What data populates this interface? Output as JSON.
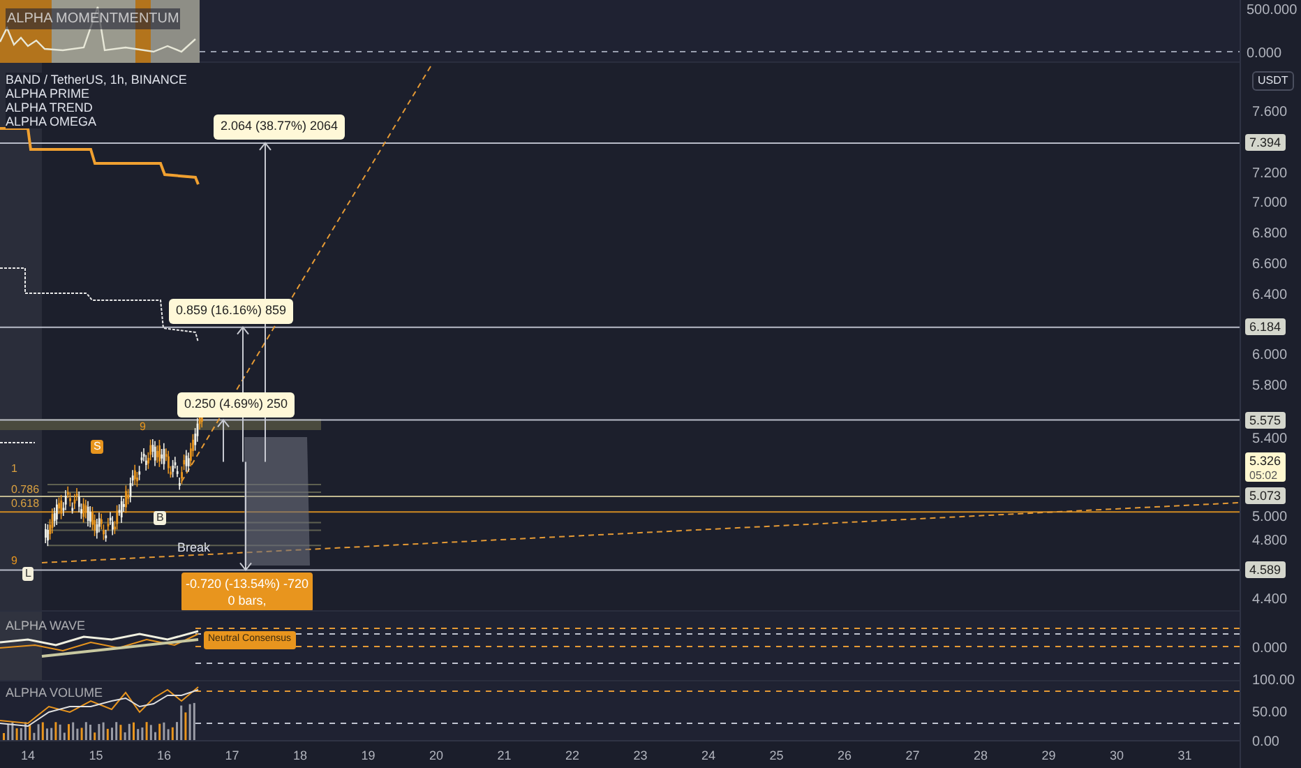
{
  "momentum_pane": {
    "title": "ALPHA MOMENTMENTUM",
    "axis_labels": [
      "500.000",
      "0.000"
    ]
  },
  "legend": {
    "symbol": "BAND / TetherUS, 1h, BINANCE",
    "indicators": [
      "ALPHA PRIME",
      "ALPHA TREND",
      "ALPHA OMEGA"
    ]
  },
  "currency_badge": "USDT",
  "price_axis": [
    "7.600",
    "7.200",
    "7.000",
    "6.800",
    "6.600",
    "6.400",
    "6.000",
    "5.800",
    "5.400",
    "5.000",
    "4.800",
    "4.400"
  ],
  "price_badges": [
    {
      "kind": "level",
      "label": "7.394"
    },
    {
      "kind": "level",
      "label": "6.184"
    },
    {
      "kind": "level",
      "label": "5.575"
    },
    {
      "kind": "current",
      "label": "5.326",
      "countdown": "05:02"
    },
    {
      "kind": "level",
      "label": "5.073"
    },
    {
      "kind": "level",
      "label": "4.589"
    }
  ],
  "measurements": [
    {
      "kind": "up",
      "label": "2.064 (38.77%) 2064"
    },
    {
      "kind": "up",
      "label": "0.859 (16.16%) 859"
    },
    {
      "kind": "up",
      "label": "0.250 (4.69%) 250"
    },
    {
      "kind": "down",
      "label": "-0.720 (-13.54%) -720",
      "detail": "0 bars,"
    }
  ],
  "fib_labels": [
    "1",
    "0.786",
    "0.618"
  ],
  "markers": [
    {
      "kind": "tag",
      "text": "S"
    },
    {
      "kind": "light",
      "text": "B"
    },
    {
      "kind": "light",
      "text": "L"
    },
    {
      "kind": "plain",
      "text": "9"
    },
    {
      "kind": "plain",
      "text": "9"
    }
  ],
  "break_label": "Break",
  "wave_pane": {
    "title": "ALPHA WAVE",
    "consensus": "Neutral Consensus",
    "axis_labels": [
      "0.000"
    ]
  },
  "volume_pane": {
    "title": "ALPHA VOLUME",
    "axis_labels": [
      "100.00",
      "50.00",
      "0.00"
    ]
  },
  "time_axis": [
    "14",
    "15",
    "16",
    "17",
    "18",
    "19",
    "20",
    "21",
    "22",
    "23",
    "24",
    "25",
    "26",
    "27",
    "28",
    "29",
    "30",
    "31"
  ]
}
